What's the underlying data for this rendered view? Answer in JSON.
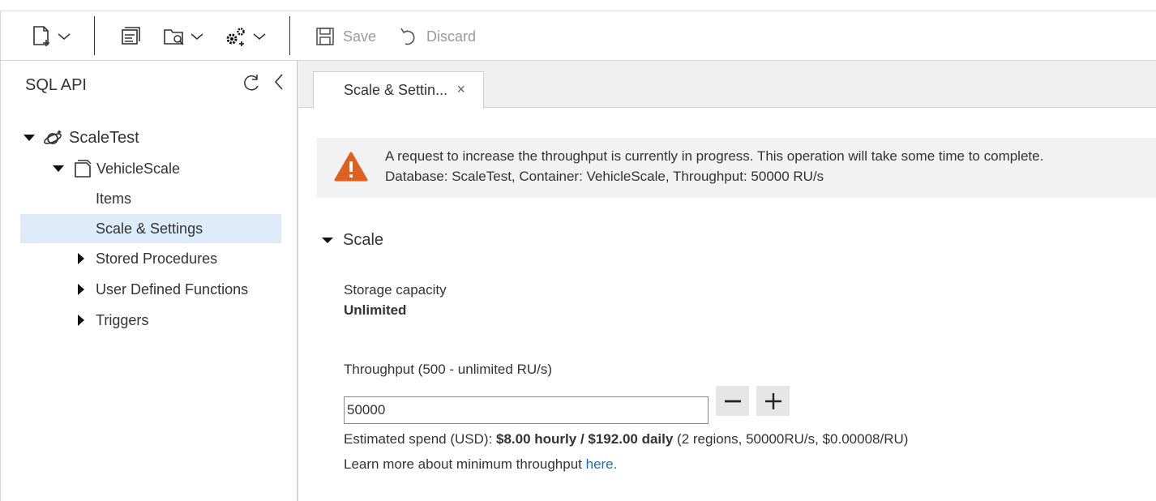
{
  "toolbar": {
    "save_label": "Save",
    "discard_label": "Discard",
    "icons": [
      "new-container-icon",
      "open-query-icon",
      "open-query-from-file-icon",
      "settings-gear-icon",
      "save-icon",
      "discard-icon"
    ]
  },
  "sidebar": {
    "title": "SQL API",
    "database": "ScaleTest",
    "container": "VehicleScale",
    "items": [
      {
        "label": "Items"
      },
      {
        "label": "Scale & Settings"
      },
      {
        "label": "Stored Procedures"
      },
      {
        "label": "User Defined Functions"
      },
      {
        "label": "Triggers"
      }
    ]
  },
  "tabs": [
    {
      "label": "Scale & Settin...",
      "close": "×"
    }
  ],
  "notice": {
    "line1": "A request to increase the throughput is currently in progress. This operation will take some time to complete.",
    "line2": "Database: ScaleTest, Container: VehicleScale, Throughput: 50000 RU/s",
    "color": "#e0601f"
  },
  "scale": {
    "section_title": "Scale",
    "storage_label": "Storage capacity",
    "storage_value": "Unlimited",
    "throughput_label": "Throughput (500 - unlimited RU/s)",
    "throughput_value": "50000",
    "spend_prefix": "Estimated spend (USD): ",
    "spend_bold": "$8.00 hourly / $192.00 daily",
    "spend_suffix": " (2 regions, 50000RU/s, $0.00008/RU)",
    "learn_more": "Learn more about minimum throughput ",
    "learn_more_link": "here."
  },
  "colors": {
    "selection": "#deecf9",
    "link": "#1a6fb6",
    "warning": "#e0601f"
  }
}
